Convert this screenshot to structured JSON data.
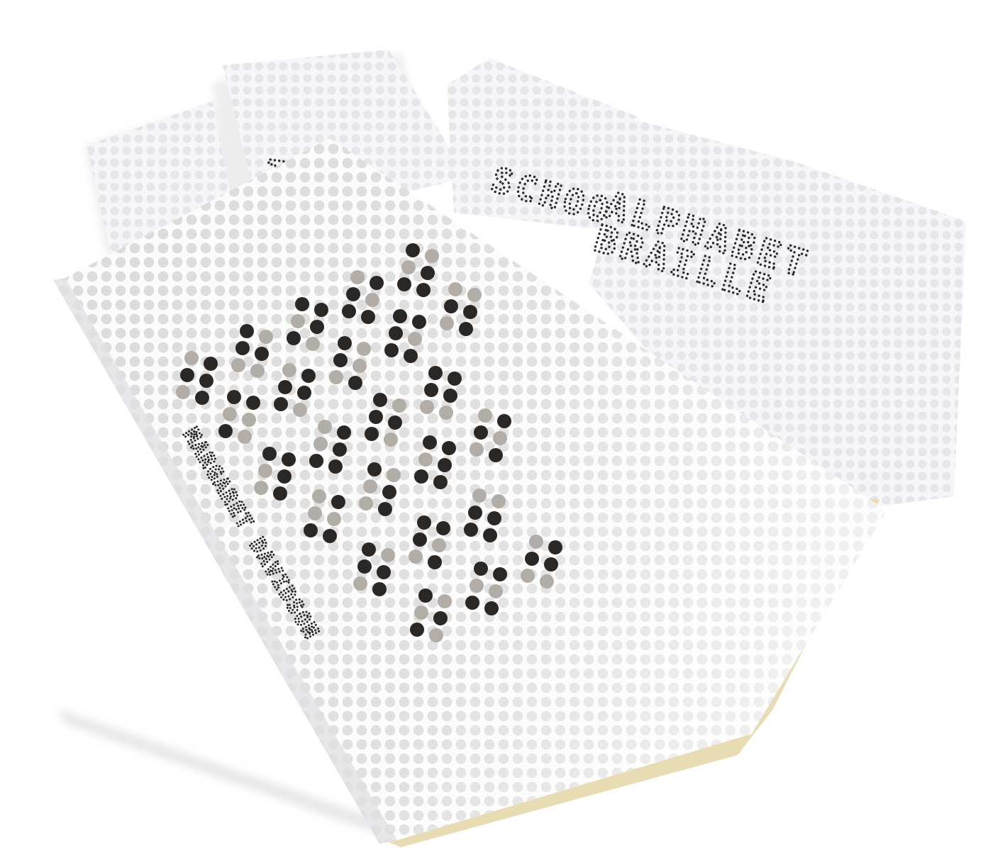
{
  "cards": [
    {
      "text": "TR"
    },
    {
      "text": "SCHOOL"
    },
    {
      "text": "ALPHABET"
    },
    {
      "text": "BRAILLE"
    }
  ],
  "spine": {
    "text": "MARGARET DAVIDSON"
  },
  "colors": {
    "background": "#ffffff",
    "card": "#f6f6f8",
    "grid_dot_light": "#e4e3e8",
    "grid_dot_cover": "#dcdbdc",
    "braille_dark": "#2b2724",
    "braille_grey": "#b3ada8",
    "book_edge": "#e8dcb4"
  },
  "braille_cover": {
    "description_note": "",
    "cells": [
      [
        0,
        1,
        1,
        1,
        0,
        1
      ],
      [
        1,
        0,
        1,
        1,
        0,
        0
      ],
      [
        1,
        1,
        0,
        1,
        1,
        0
      ],
      [
        0,
        1,
        1,
        0,
        1,
        1
      ],
      [
        1,
        0,
        0,
        1,
        1,
        1
      ],
      [
        1,
        1,
        0,
        0,
        1,
        0
      ],
      [
        0,
        1,
        1,
        1,
        1,
        0
      ],
      [
        1,
        0,
        1,
        0,
        0,
        1
      ],
      [
        1,
        1,
        1,
        0,
        1,
        1
      ],
      [
        0,
        0,
        1,
        1,
        0,
        1
      ],
      [
        1,
        1,
        0,
        1,
        0,
        1
      ],
      [
        0,
        1,
        0,
        1,
        1,
        1
      ],
      [
        1,
        0,
        1,
        1,
        1,
        0
      ],
      [
        1,
        1,
        1,
        1,
        0,
        0
      ],
      [
        0,
        1,
        0,
        0,
        1,
        1
      ],
      [
        1,
        0,
        0,
        1,
        0,
        1
      ],
      [
        1,
        1,
        0,
        1,
        1,
        1
      ],
      [
        0,
        1,
        1,
        0,
        0,
        1
      ],
      [
        1,
        0,
        1,
        1,
        0,
        1
      ],
      [
        1,
        1,
        1,
        0,
        0,
        1
      ],
      [
        0,
        0,
        1,
        1,
        1,
        1
      ],
      [
        1,
        0,
        0,
        1,
        1,
        0
      ],
      [
        1,
        1,
        0,
        0,
        1,
        1
      ],
      [
        0,
        1,
        1,
        1,
        0,
        0
      ]
    ]
  }
}
